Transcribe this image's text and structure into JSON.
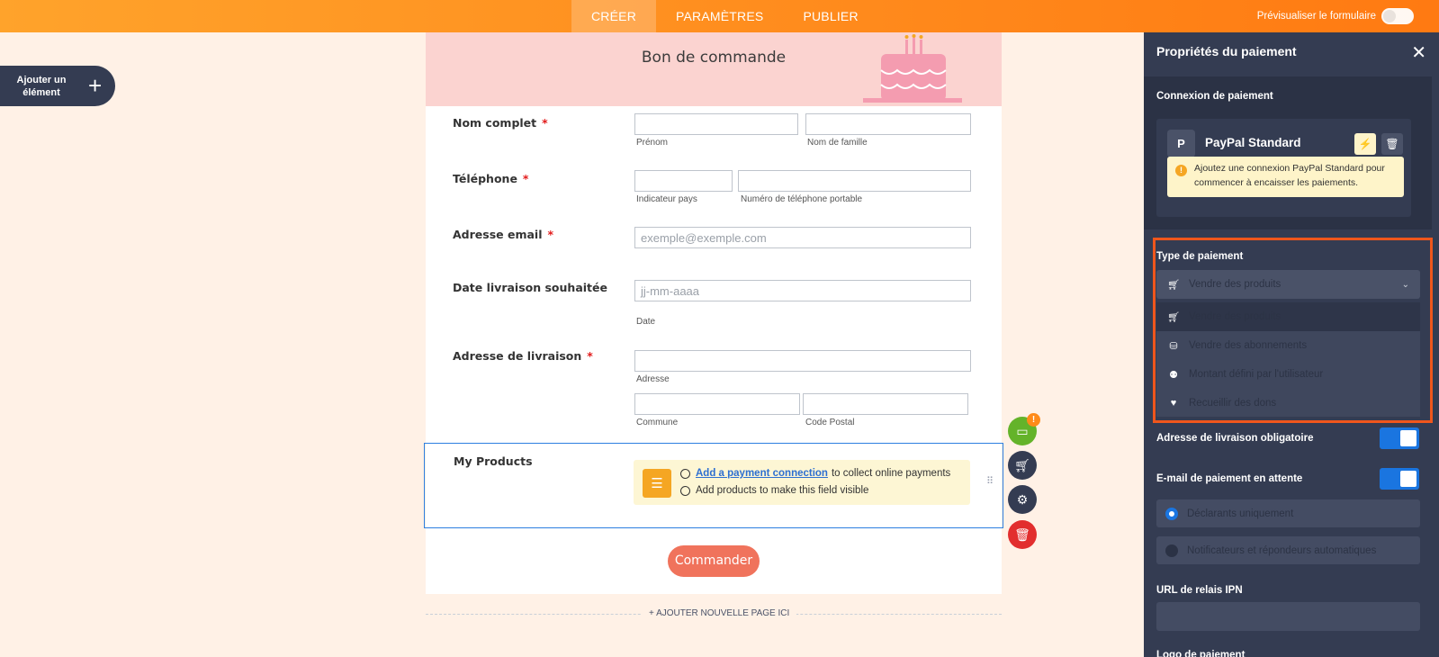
{
  "topbar": {
    "tabs": [
      {
        "label": "CRÉER"
      },
      {
        "label": "PARAMÈTRES"
      },
      {
        "label": "PUBLIER"
      }
    ],
    "preview_label": "Prévisualiser le formulaire"
  },
  "add_element": {
    "label": "Ajouter un élément"
  },
  "form": {
    "title": "Bon de commande",
    "fields": [
      {
        "label": "Nom complet",
        "required": "*",
        "sublabels": [
          "Prénom",
          "Nom de famille"
        ]
      },
      {
        "label": "Téléphone",
        "required": "*",
        "sublabels": [
          "Indicateur pays",
          "Numéro de téléphone portable"
        ]
      },
      {
        "label": "Adresse email",
        "required": "*",
        "placeholder": "exemple@exemple.com"
      },
      {
        "label": "Date livraison souhaitée",
        "placeholder": "jj-mm-aaaa",
        "sublabel": "Date"
      },
      {
        "label": "Adresse de livraison",
        "required": "*",
        "sublabels": [
          "Adresse",
          "Commune",
          "Code Postal"
        ]
      }
    ],
    "products": {
      "label": "My Products",
      "link": "Add a payment connection",
      "line1_rest": "to collect online payments",
      "line2": "Add products to make this field visible"
    },
    "submit": "Commander",
    "add_page": "+ AJOUTER NOUVELLE PAGE ICI"
  },
  "field_tools": {
    "badge": "!",
    "icons": [
      "payment-icon",
      "cart-icon",
      "gear-icon",
      "trash-icon"
    ]
  },
  "panel": {
    "title": "Propriétés du paiement",
    "close": "✕",
    "connection_label": "Connexion de paiement",
    "provider": "PayPal Standard",
    "provider_glyph": "P",
    "warning": "Ajoutez une connexion PayPal Standard pour commencer à encaisser les paiements.",
    "payment_type_label": "Type de paiement",
    "payment_type_selected": "Vendre des produits",
    "options": [
      "Vendre des produits",
      "Vendre des abonnements",
      "Montant défini par l'utilisateur",
      "Recueillir des dons"
    ],
    "shipping_required": "Adresse de livraison obligatoire",
    "pending_email": "E-mail de paiement en attente",
    "radio_options": [
      "Déclarants uniquement",
      "Notificateurs et répondeurs automatiques"
    ],
    "ipn_label": "URL de relais IPN",
    "logo_label": "Logo de paiement"
  },
  "colors": {
    "accent": "#ff8a1c",
    "panel": "#343c52",
    "highlight": "#f0561c",
    "toggle": "#1a75e0",
    "submit": "#f0735c"
  }
}
